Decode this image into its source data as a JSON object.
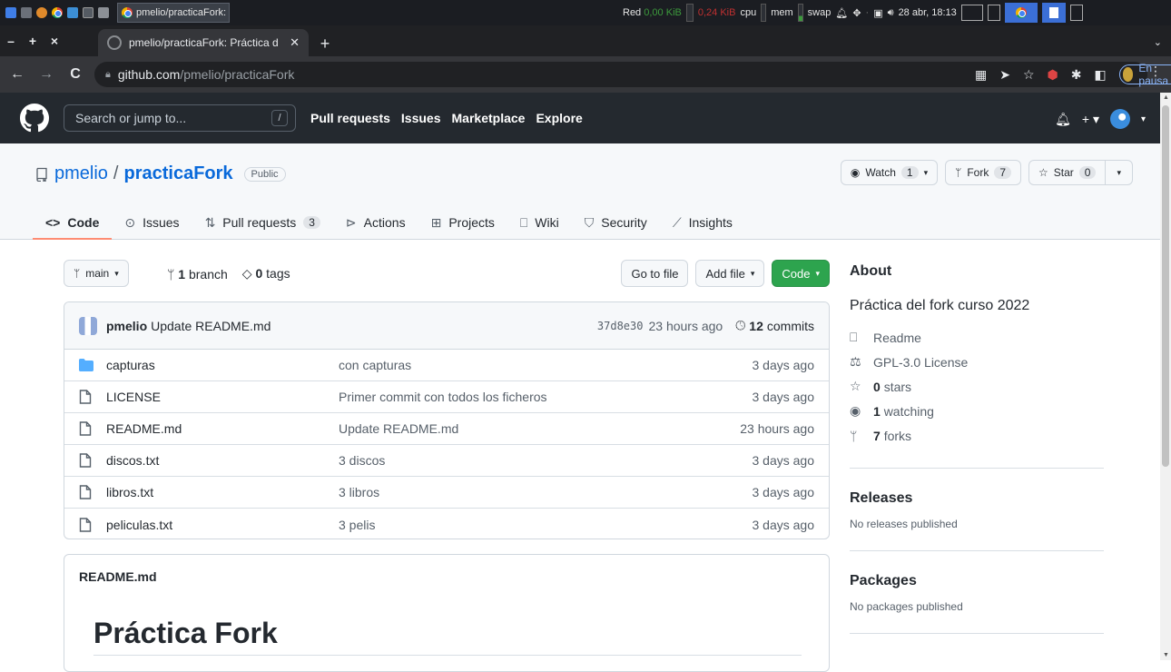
{
  "taskbar": {
    "window_title": "pmelio/practicaFork: Práctic...",
    "net_label": "Red",
    "net_down": "0,00",
    "net_down_unit": "KiB",
    "net_up": "0,24",
    "net_up_unit": "KiB",
    "cpu": "cpu",
    "mem": "mem",
    "swap": "swap",
    "datetime": "28 abr, 18:13"
  },
  "browser": {
    "tab_title": "pmelio/practicaFork: Práctica d",
    "new_tab": "+",
    "url_host": "github.com",
    "url_path": "/pmelio/practicaFork",
    "profile_status": "En pausa"
  },
  "github": {
    "search_placeholder": "Search or jump to...",
    "search_shortcut": "/",
    "nav": [
      "Pull requests",
      "Issues",
      "Marketplace",
      "Explore"
    ]
  },
  "repo": {
    "owner": "pmelio",
    "separator": "/",
    "name": "practicaFork",
    "visibility": "Public",
    "watch_label": "Watch",
    "watch_count": "1",
    "fork_label": "Fork",
    "fork_count": "7",
    "star_label": "Star",
    "star_count": "0",
    "tabs": [
      {
        "label": "Code",
        "icon": "code-icon",
        "count": ""
      },
      {
        "label": "Issues",
        "icon": "issue-icon",
        "count": ""
      },
      {
        "label": "Pull requests",
        "icon": "pull-request-icon",
        "count": "3"
      },
      {
        "label": "Actions",
        "icon": "play-icon",
        "count": ""
      },
      {
        "label": "Projects",
        "icon": "table-icon",
        "count": ""
      },
      {
        "label": "Wiki",
        "icon": "book-icon",
        "count": ""
      },
      {
        "label": "Security",
        "icon": "shield-icon",
        "count": ""
      },
      {
        "label": "Insights",
        "icon": "graph-icon",
        "count": ""
      }
    ]
  },
  "toolbar": {
    "branch": "main",
    "branch_count": "1",
    "branch_word": "branch",
    "tag_count": "0",
    "tag_word": "tags",
    "go_to_file": "Go to file",
    "add_file": "Add file",
    "code": "Code"
  },
  "commit": {
    "author": "pmelio",
    "message": "Update README.md",
    "sha": "37d8e30",
    "time": "23 hours ago",
    "count": "12",
    "count_word": "commits"
  },
  "files": [
    {
      "type": "dir",
      "name": "capturas",
      "message": "con capturas",
      "age": "3 days ago"
    },
    {
      "type": "file",
      "name": "LICENSE",
      "message": "Primer commit con todos los ficheros",
      "age": "3 days ago"
    },
    {
      "type": "file",
      "name": "README.md",
      "message": "Update README.md",
      "age": "23 hours ago"
    },
    {
      "type": "file",
      "name": "discos.txt",
      "message": "3 discos",
      "age": "3 days ago"
    },
    {
      "type": "file",
      "name": "libros.txt",
      "message": "3 libros",
      "age": "3 days ago"
    },
    {
      "type": "file",
      "name": "peliculas.txt",
      "message": "3 pelis",
      "age": "3 days ago"
    }
  ],
  "readme": {
    "filename": "README.md",
    "heading": "Práctica Fork"
  },
  "about": {
    "title": "About",
    "description": "Práctica del fork curso 2022",
    "readme": "Readme",
    "license": "GPL-3.0 License",
    "stars_count": "0",
    "stars_word": "stars",
    "watching_count": "1",
    "watching_word": "watching",
    "forks_count": "7",
    "forks_word": "forks"
  },
  "releases": {
    "title": "Releases",
    "empty": "No releases published"
  },
  "packages": {
    "title": "Packages",
    "empty": "No packages published"
  },
  "colors": {
    "accent_link": "#0969da",
    "code_button": "#2da44e",
    "tab_underline": "#fd8c73",
    "header_bg": "#24292f"
  }
}
